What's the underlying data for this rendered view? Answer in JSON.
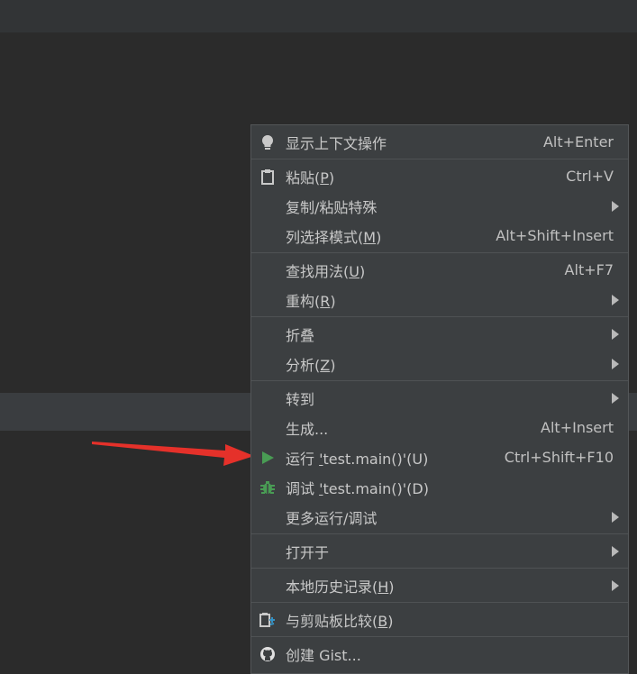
{
  "colors": {
    "background": "#2b2b2b",
    "menu_bg": "#3c3f41",
    "separator": "#4f5254",
    "text": "#c8c8c8",
    "run_green": "#499c54",
    "arrow_red": "#e5312a"
  },
  "menu": {
    "groups": [
      {
        "items": [
          {
            "icon": "lightbulb-icon",
            "label": "显示上下文操作",
            "shortcut": "Alt+Enter"
          }
        ]
      },
      {
        "items": [
          {
            "icon": "clipboard-icon",
            "label_pre": "粘贴(",
            "mnemonic": "P",
            "label_post": ")",
            "shortcut": "Ctrl+V"
          },
          {
            "label": "复制/粘贴特殊",
            "submenu": true
          },
          {
            "label_pre": "列选择模式(",
            "mnemonic": "M",
            "label_post": ")",
            "shortcut": "Alt+Shift+Insert"
          }
        ]
      },
      {
        "items": [
          {
            "label_pre": "查找用法(",
            "mnemonic": "U",
            "label_post": ")",
            "shortcut": "Alt+F7"
          },
          {
            "label_pre": "重构(",
            "mnemonic": "R",
            "label_post": ")",
            "submenu": true
          }
        ]
      },
      {
        "items": [
          {
            "label": "折叠",
            "submenu": true
          },
          {
            "label_pre": "分析(",
            "mnemonic": "Z",
            "label_post": ")",
            "submenu": true
          }
        ]
      },
      {
        "items": [
          {
            "label": "转到",
            "submenu": true
          },
          {
            "label": "生成...",
            "shortcut": "Alt+Insert"
          },
          {
            "icon": "run-icon",
            "label_pre": "运行 ",
            "mnemonic": "'",
            "label_post": "test.main()'(U)",
            "shortcut": "Ctrl+Shift+F10"
          },
          {
            "icon": "debug-icon",
            "label_pre": "调试 ",
            "mnemonic": "'",
            "label_post": "test.main()'(D)"
          },
          {
            "label": "更多运行/调试",
            "submenu": true
          }
        ]
      },
      {
        "items": [
          {
            "label": "打开于",
            "submenu": true
          }
        ]
      },
      {
        "items": [
          {
            "label_pre": "本地历史记录(",
            "mnemonic": "H",
            "label_post": ")",
            "submenu": true
          }
        ]
      },
      {
        "items": [
          {
            "icon": "compare-clipboard-icon",
            "label_pre": "与剪贴板比较(",
            "mnemonic": "B",
            "label_post": ")"
          }
        ]
      },
      {
        "items": [
          {
            "icon": "github-icon",
            "label": "创建 Gist..."
          }
        ]
      }
    ]
  }
}
